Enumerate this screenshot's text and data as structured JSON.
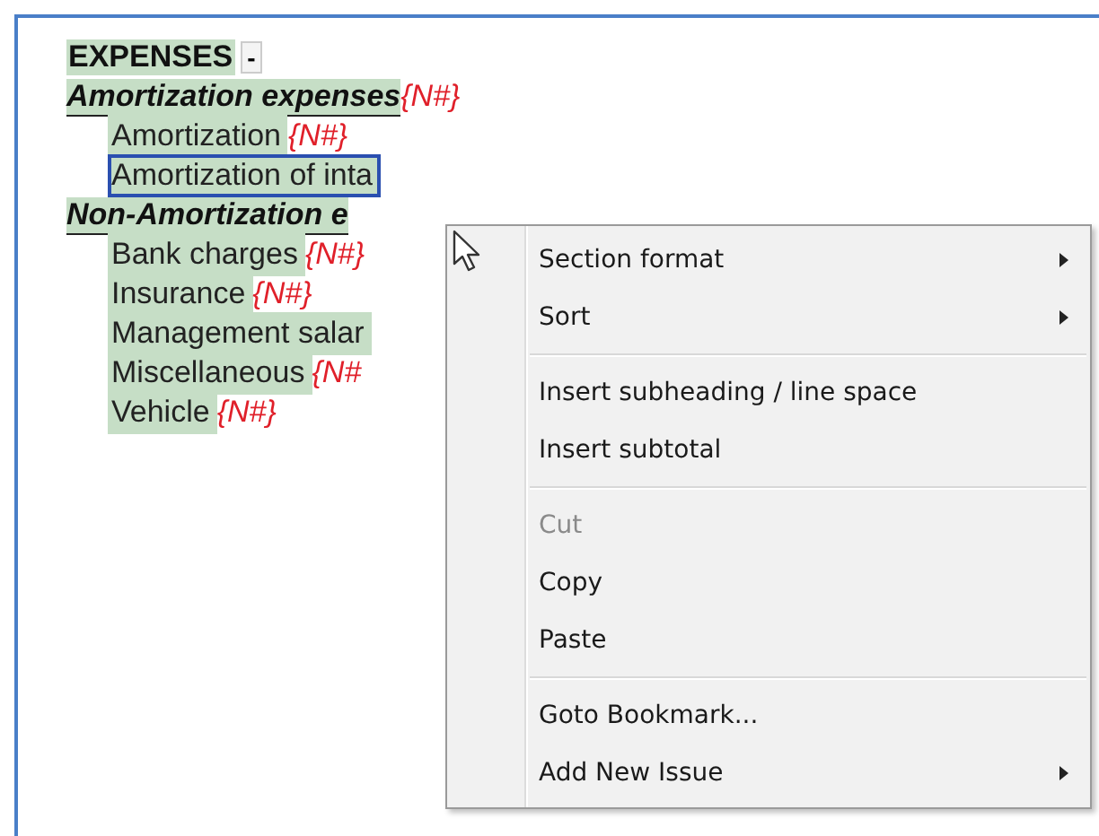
{
  "heading": {
    "text": "EXPENSES",
    "dropdown": "-"
  },
  "tree": [
    {
      "label": "Amortization expenses",
      "code": "{N#}",
      "selected": false,
      "children": [
        {
          "label": "Amortization",
          "code": "{N#}",
          "selected": false
        },
        {
          "label": "Amortization of inta",
          "selected": true
        }
      ]
    },
    {
      "label": "Non-Amortization e",
      "selected": false,
      "children": [
        {
          "label": "Bank charges",
          "code": "{N#}",
          "selected": false
        },
        {
          "label": "Insurance",
          "code": "{N#}",
          "selected": false
        },
        {
          "label": "Management salar",
          "selected": false
        },
        {
          "label": "Miscellaneous",
          "code": "{N#",
          "selected": false
        },
        {
          "label": "Vehicle",
          "code": "{N#}",
          "selected": false
        }
      ]
    }
  ],
  "context_menu": [
    {
      "kind": "item",
      "label": "Section format",
      "submenu": true,
      "disabled": false
    },
    {
      "kind": "item",
      "label": "Sort",
      "submenu": true,
      "disabled": false
    },
    {
      "kind": "separator"
    },
    {
      "kind": "item",
      "label": "Insert subheading / line space",
      "submenu": false,
      "disabled": false
    },
    {
      "kind": "item",
      "label": "Insert subtotal",
      "submenu": false,
      "disabled": false
    },
    {
      "kind": "separator"
    },
    {
      "kind": "item",
      "label": "Cut",
      "submenu": false,
      "disabled": true
    },
    {
      "kind": "item",
      "label": "Copy",
      "submenu": false,
      "disabled": false
    },
    {
      "kind": "item",
      "label": "Paste",
      "submenu": false,
      "disabled": false
    },
    {
      "kind": "separator"
    },
    {
      "kind": "item",
      "label": "Goto Bookmark...",
      "submenu": false,
      "disabled": false
    },
    {
      "kind": "item",
      "label": "Add New Issue",
      "submenu": true,
      "disabled": false
    }
  ]
}
